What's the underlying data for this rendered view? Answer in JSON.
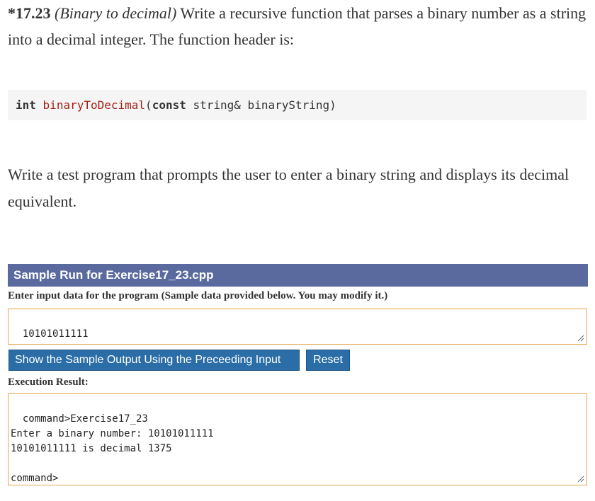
{
  "problem": {
    "number": "*17.23",
    "title": "(Binary to decimal)",
    "text": " Write a recursive function that parses a binary number as a string into a decimal integer. The function header is:"
  },
  "code": {
    "return_type": "int",
    "function_name": "binaryToDecimal",
    "open_paren": "(",
    "param_keyword": "const",
    "param_rest": " string& binaryString)"
  },
  "paragraph2": "Write a test program that prompts the user to enter a binary string and displays its decimal equivalent.",
  "sample_run": {
    "header": "Sample Run for Exercise17_23.cpp",
    "input_label": "Enter input data for the program (Sample data provided below. You may modify it.)",
    "input_value": "10101011111",
    "show_button": "Show the Sample Output Using the Preceeding Input",
    "reset_button": "Reset",
    "result_label": "Execution Result:",
    "output_text": "command>Exercise17_23\nEnter a binary number: 10101011111\n10101011111 is decimal 1375\n\ncommand>"
  }
}
